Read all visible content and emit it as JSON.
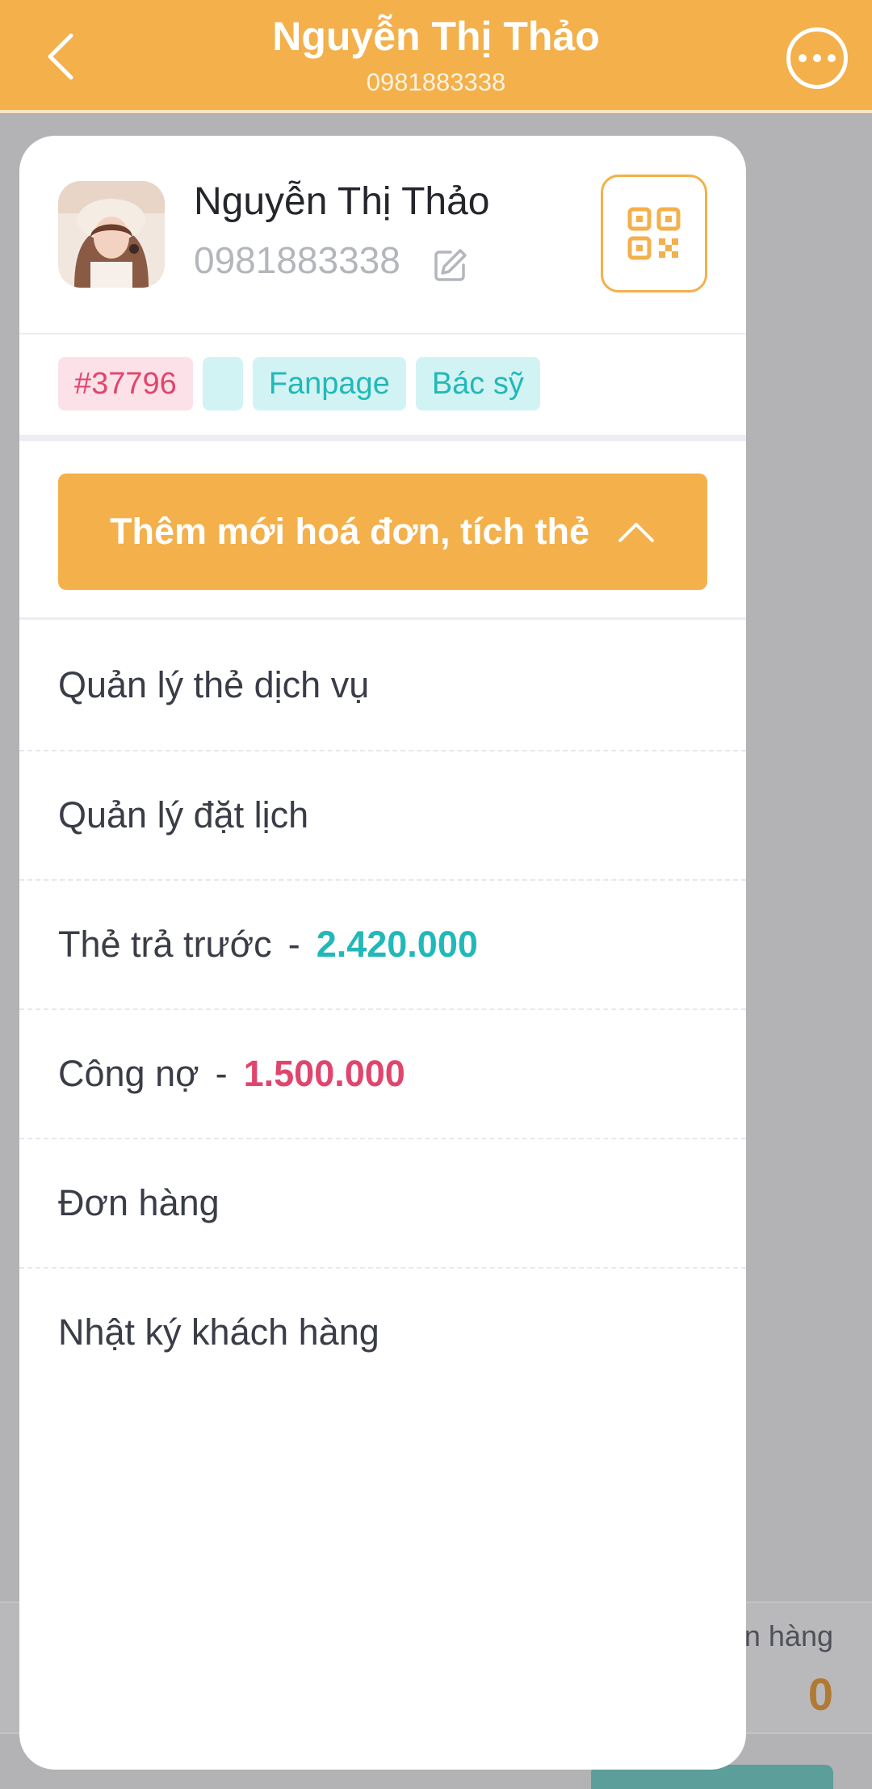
{
  "header": {
    "title": "Nguyễn Thị Thảo",
    "subtitle": "0981883338",
    "back_icon": "chevron-left-icon",
    "more_icon": "more-horizontal-icon"
  },
  "profile": {
    "name": "Nguyễn Thị Thảo",
    "phone": "0981883338",
    "edit_icon": "edit-pencil-icon",
    "qr_icon": "qr-code-icon"
  },
  "tags": [
    {
      "label": "#37796",
      "color": "#e0456d"
    },
    {
      "label": "",
      "color": "#23b8b8"
    },
    {
      "label": "Fanpage",
      "color": "#23b8b8"
    },
    {
      "label": "Bác sỹ",
      "color": "#23b8b8"
    }
  ],
  "add_button": {
    "label": "Thêm mới hoá đơn, tích thẻ",
    "icon": "chevron-up-icon"
  },
  "menu": [
    {
      "label": "Quản lý thẻ dịch vụ"
    },
    {
      "label": "Quản lý đặt lịch"
    },
    {
      "label": "Thẻ trả trước",
      "sep": "-",
      "value": "2.420.000",
      "value_color": "#23b8b8"
    },
    {
      "label": "Công nợ",
      "sep": "-",
      "value": "1.500.000",
      "value_color": "#e0456d"
    },
    {
      "label": "Đơn hàng"
    },
    {
      "label": "Nhật ký khách hàng"
    }
  ],
  "background": {
    "stat_label": "n hàng",
    "stat_value": "0"
  },
  "colors": {
    "accent": "#f3b04b",
    "teal": "#23b8b8",
    "red": "#e0456d"
  }
}
